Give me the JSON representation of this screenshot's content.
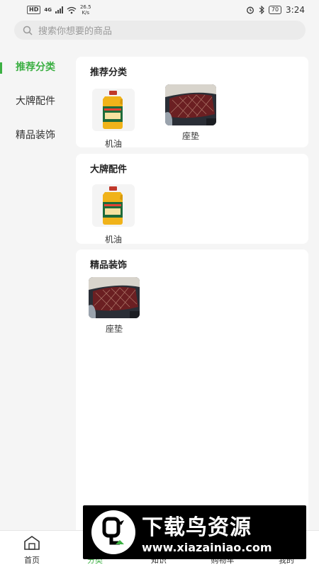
{
  "status_bar": {
    "network": "4G",
    "speed_value": "26.5",
    "speed_unit": "K/s",
    "battery": "70",
    "time": "3:24"
  },
  "search": {
    "placeholder": "搜索你想要的商品"
  },
  "sidebar": {
    "items": [
      {
        "label": "推荐分类",
        "active": true
      },
      {
        "label": "大牌配件",
        "active": false
      },
      {
        "label": "精品装饰",
        "active": false
      }
    ]
  },
  "sections": [
    {
      "title": "推荐分类",
      "items": [
        {
          "label": "机油",
          "icon": "oil-bottle-icon"
        },
        {
          "label": "座垫",
          "icon": "seat-cushion-icon"
        }
      ]
    },
    {
      "title": "大牌配件",
      "items": [
        {
          "label": "机油",
          "icon": "oil-bottle-icon"
        }
      ]
    },
    {
      "title": "精品装饰",
      "items": [
        {
          "label": "座垫",
          "icon": "seat-cushion-icon"
        }
      ]
    }
  ],
  "tabbar": {
    "items": [
      {
        "label": "首页",
        "active": false
      },
      {
        "label": "分类",
        "active": true
      },
      {
        "label": "知识",
        "active": false
      },
      {
        "label": "购物车",
        "active": false
      },
      {
        "label": "我的",
        "active": false
      }
    ]
  },
  "watermark": {
    "title": "下载鸟资源",
    "url": "www.xiazainiao.com"
  },
  "colors": {
    "accent": "#3cb043",
    "background": "#f5f5f5",
    "card": "#ffffff"
  }
}
